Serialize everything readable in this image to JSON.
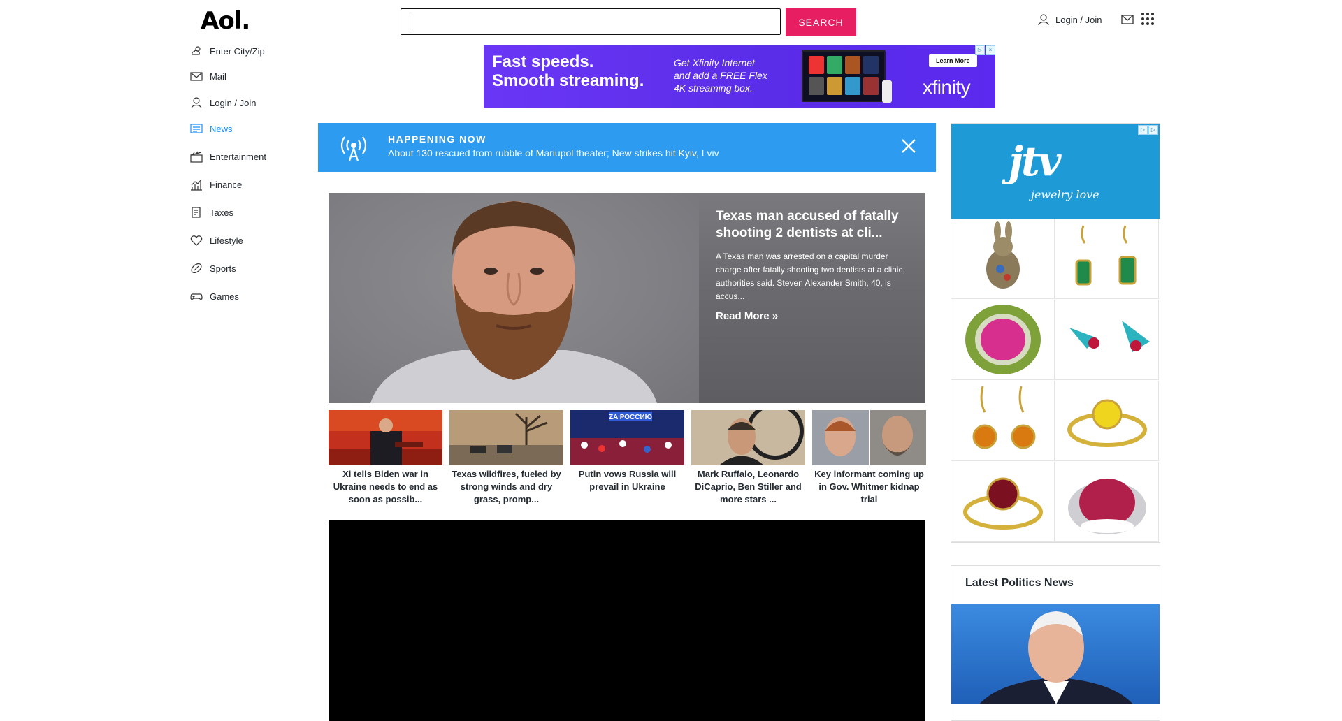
{
  "brand": {
    "logo": "Aol."
  },
  "search": {
    "placeholder": "",
    "button_label": "SEARCH"
  },
  "header": {
    "login_label": "Login / Join"
  },
  "nav": {
    "items": [
      {
        "label": "Enter City/Zip",
        "icon": "weather-icon"
      },
      {
        "label": "Mail",
        "icon": "mail-icon"
      },
      {
        "label": "Login / Join",
        "icon": "user-icon"
      },
      {
        "label": "News",
        "icon": "news-icon",
        "active": true
      },
      {
        "label": "Entertainment",
        "icon": "clapperboard-icon"
      },
      {
        "label": "Finance",
        "icon": "chart-icon"
      },
      {
        "label": "Taxes",
        "icon": "document-icon"
      },
      {
        "label": "Lifestyle",
        "icon": "heart-icon"
      },
      {
        "label": "Sports",
        "icon": "football-icon"
      },
      {
        "label": "Games",
        "icon": "gamepad-icon"
      }
    ]
  },
  "top_ad": {
    "headline_1": "Fast speeds.",
    "headline_2": "Smooth streaming.",
    "sub_1": "Get Xfinity Internet",
    "sub_2": "and add a FREE Flex",
    "sub_3": "4K streaming box.",
    "cta": "Learn More",
    "brand": "xfinity"
  },
  "breaking": {
    "label": "HAPPENING NOW",
    "text": "About 130 rescued from rubble of Mariupol theater; New strikes hit Kyiv, Lviv"
  },
  "hero": {
    "title": "Texas man accused of fatally shooting 2 dentists at cli...",
    "summary": "A Texas man was arrested on a capital murder charge after fatally shooting two dentists at a clinic, authorities said. Steven Alexander Smith, 40, is accus...",
    "read_more": "Read More »"
  },
  "thumbs": [
    {
      "caption": "Xi tells Biden war in Ukraine needs to end as soon as possib..."
    },
    {
      "caption": "Texas wildfires, fueled by strong winds and dry grass, promp..."
    },
    {
      "caption": "Putin vows Russia will prevail in Ukraine",
      "overlay": "ZA РОССИЮ"
    },
    {
      "caption": "Mark Ruffalo, Leonardo DiCaprio, Ben Stiller and more stars ..."
    },
    {
      "caption": "Key informant coming up in Gov. Whitmer kidnap trial"
    }
  ],
  "jtv_ad": {
    "logo": "jtv",
    "tagline": "jewelry love"
  },
  "politics": {
    "title": "Latest Politics News"
  },
  "colors": {
    "accent": "#e81e63",
    "nav_active": "#188fff",
    "breaking_bg": "#2d9bf0",
    "ad_purple": "#5a2de8",
    "jtv_blue": "#1e9bd7"
  }
}
